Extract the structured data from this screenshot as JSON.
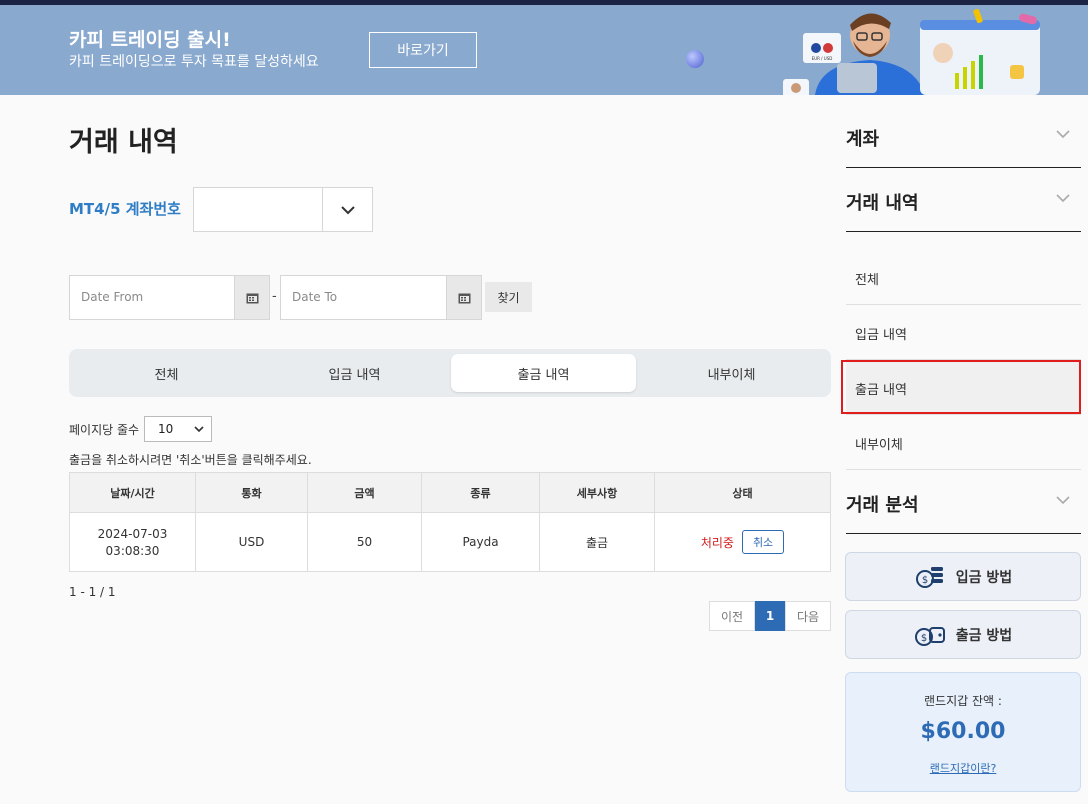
{
  "banner": {
    "title": "카피 트레이딩 출시!",
    "subtitle": "카피 트레이딩으로 투자 목표를 달성하세요",
    "button": "바로가기",
    "art": {
      "currency_badge": "EUR / USD"
    }
  },
  "page": {
    "title": "거래 내역"
  },
  "account": {
    "label": "MT4/5 계좌번호",
    "value": ""
  },
  "dates": {
    "from_placeholder": "Date From",
    "to_placeholder": "Date To",
    "separator": "-",
    "search_label": "찾기"
  },
  "tabs": [
    {
      "label": "전체",
      "active": false
    },
    {
      "label": "입금 내역",
      "active": false
    },
    {
      "label": "출금 내역",
      "active": true
    },
    {
      "label": "내부이체",
      "active": false
    }
  ],
  "perpage": {
    "label": "페이지당 줄수",
    "value": "10"
  },
  "cancel_note": "출금을 취소하시려면 '취소'버튼을 클릭해주세요.",
  "table": {
    "headers": [
      "날짜/시간",
      "통화",
      "금액",
      "종류",
      "세부사항",
      "상태"
    ],
    "rows": [
      {
        "date": "2024-07-03",
        "time": "03:08:30",
        "currency": "USD",
        "amount": "50",
        "type": "Payda",
        "detail": "출금",
        "status": "처리중",
        "action": "취소"
      }
    ]
  },
  "range_text": "1 - 1 / 1",
  "pagination": {
    "prev": "이전",
    "current": "1",
    "next": "다음"
  },
  "sidebar": {
    "sections": [
      {
        "label": "계좌"
      },
      {
        "label": "거래 내역"
      },
      {
        "label": "거래 분석"
      }
    ],
    "items": [
      {
        "label": "전체"
      },
      {
        "label": "입금 내역"
      },
      {
        "label": "출금 내역",
        "selected": true
      },
      {
        "label": "내부이체"
      }
    ],
    "buttons": [
      {
        "label": "입금 방법",
        "icon": "coins-icon"
      },
      {
        "label": "출금 방법",
        "icon": "wallet-icon"
      }
    ],
    "wallet": {
      "label": "랜드지갑 잔액 :",
      "amount": "$60.00",
      "link": "랜드지갑이란?"
    }
  },
  "colors": {
    "accent": "#2d6bb5",
    "status_pending": "#d21b1b",
    "highlight": "#e01c1c",
    "banner": "#8aa9cf"
  }
}
